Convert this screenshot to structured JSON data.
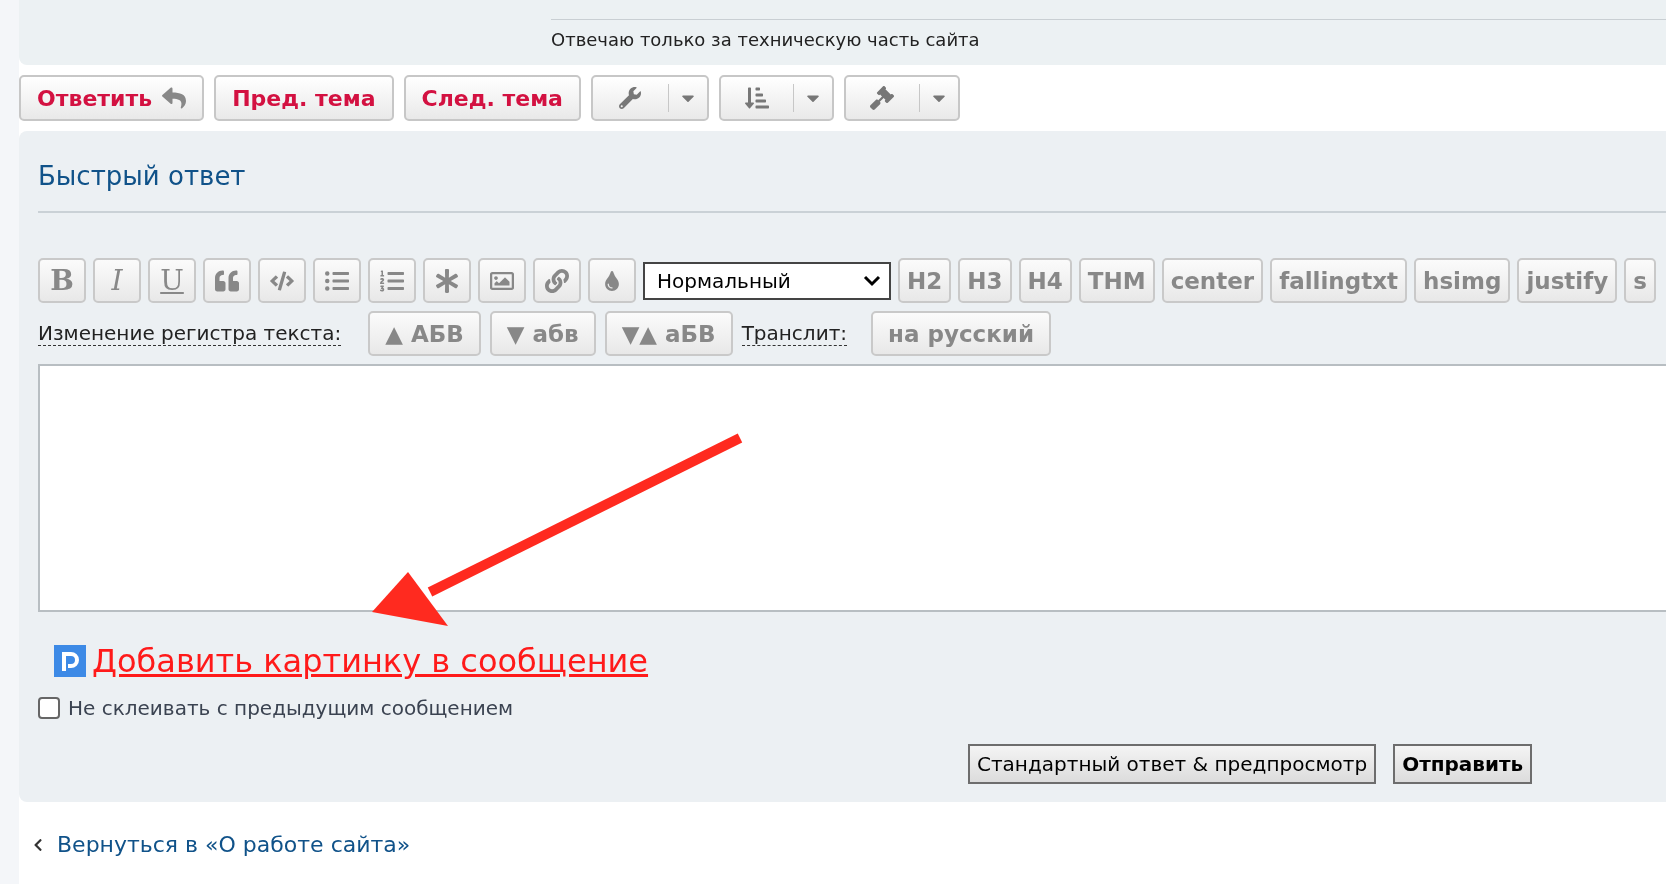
{
  "header": {
    "signature": "Отвечаю только за техническую часть сайта"
  },
  "actions": [
    {
      "kind": "reply",
      "label": "Ответить"
    },
    {
      "kind": "text",
      "label": "Пред. тема"
    },
    {
      "kind": "text",
      "label": "След. тема"
    },
    {
      "kind": "wrench"
    },
    {
      "kind": "sort"
    },
    {
      "kind": "gavel"
    }
  ],
  "quick_reply": {
    "title": "Быстрый ответ",
    "format_buttons": [
      {
        "kind": "bold",
        "label": "B"
      },
      {
        "kind": "italic",
        "label": "I"
      },
      {
        "kind": "underline",
        "label": "U"
      },
      {
        "kind": "quote"
      },
      {
        "kind": "code"
      },
      {
        "kind": "list"
      },
      {
        "kind": "numbered"
      },
      {
        "kind": "asterisk"
      },
      {
        "kind": "image"
      },
      {
        "kind": "link"
      },
      {
        "kind": "color"
      }
    ],
    "style_select": {
      "value": "Нормальный"
    },
    "tag_buttons": [
      "H2",
      "H3",
      "H4",
      "THM",
      "center",
      "fallingtxt",
      "hsimg",
      "justify",
      "s"
    ],
    "case_label": "Изменение регистра текста:",
    "case_buttons": [
      "▲ АБВ",
      "▼ абв",
      "▼▲ аБВ"
    ],
    "translit_label": "Транслит:",
    "translit_button": "на русский",
    "attach_link": "Добавить картинку в сообщение",
    "no_merge": {
      "label": "Не склеивать с предыдущим сообщением",
      "checked": false
    },
    "submit_buttons": [
      {
        "label": "Стандартный ответ & предпросмотр",
        "primary": false
      },
      {
        "label": "Отправить",
        "primary": true
      }
    ]
  },
  "back_link": "Вернуться в «О работе сайта»"
}
